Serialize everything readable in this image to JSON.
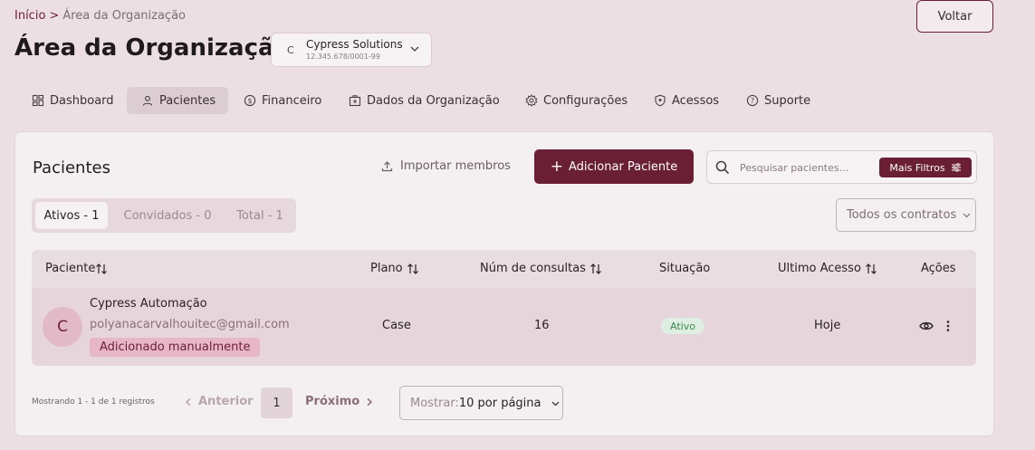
{
  "breadcrumb": {
    "home": "Início",
    "separator": ">",
    "current": "Área da Organização"
  },
  "header": {
    "title": "Área da Organização",
    "back_label": "Voltar",
    "org": {
      "initial": "C",
      "name": "Cypress Solutions",
      "cnpj": "12.345.678/0001-99"
    }
  },
  "tabs": [
    {
      "label": "Dashboard",
      "icon": "dashboard-icon",
      "active": false
    },
    {
      "label": "Pacientes",
      "icon": "user-icon",
      "active": true
    },
    {
      "label": "Financeiro",
      "icon": "dollar-icon",
      "active": false
    },
    {
      "label": "Dados da Organização",
      "icon": "briefcase-icon",
      "active": false
    },
    {
      "label": "Configurações",
      "icon": "gear-icon",
      "active": false
    },
    {
      "label": "Acessos",
      "icon": "shield-icon",
      "active": false
    },
    {
      "label": "Suporte",
      "icon": "help-icon",
      "active": false
    }
  ],
  "patients": {
    "title": "Pacientes",
    "import_label": "Importar membros",
    "add_label": "Adicionar Paciente",
    "search_placeholder": "Pesquisar pacientes...",
    "filters_label": "Mais Filtros",
    "status_tabs": [
      "Ativos - 1",
      "Convidados - 0",
      "Total - 1"
    ],
    "active_status_tab": 0,
    "contracts_label": "Todos os contratos"
  },
  "table": {
    "columns": [
      "Paciente",
      "Plano",
      "Núm de consultas",
      "Situação",
      "Ultimo Acesso",
      "Ações"
    ],
    "rows": [
      {
        "initial": "C",
        "name": "Cypress Automação",
        "email": "polyanacarvalhouitec@gmail.com",
        "tag": "Adicionado manualmente",
        "plan": "Case",
        "consultations": "16",
        "status": "Ativo",
        "last_access": "Hoje"
      }
    ]
  },
  "pagination": {
    "info": "Mostrando 1 - 1 de 1 registros",
    "prev_label": "Anterior",
    "current_page": "1",
    "next_label": "Próximo",
    "per_page_label": "Mostrar:",
    "per_page_value": "10 por página"
  },
  "colors": {
    "brand": "#6b1f35",
    "background": "#ecdfe3",
    "card": "#f4eff1",
    "status_active": "#3d8a4e"
  }
}
